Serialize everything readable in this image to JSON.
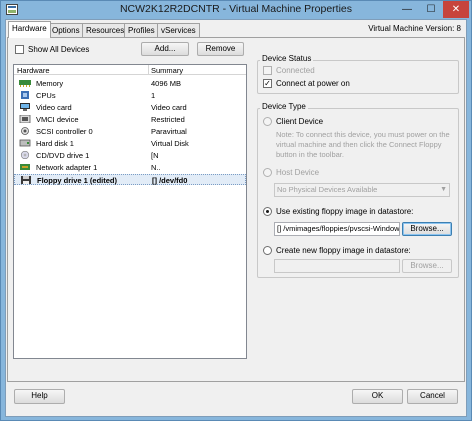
{
  "window": {
    "title": "NCW2K12R2DCNTR - Virtual Machine Properties",
    "controls": {
      "minimize": "—",
      "maximize": "☐",
      "close": "✕"
    }
  },
  "tabs": [
    "Hardware",
    "Options",
    "Resources",
    "Profiles",
    "vServices"
  ],
  "vm_version": "Virtual Machine Version: 8",
  "hardware": {
    "show_all_devices_label": "Show All Devices",
    "add_label": "Add...",
    "remove_label": "Remove",
    "columns": {
      "name": "Hardware",
      "summary": "Summary"
    },
    "rows": [
      {
        "name": "Memory",
        "summary": "4096 MB",
        "icon": "memory-icon"
      },
      {
        "name": "CPUs",
        "summary": "1",
        "icon": "cpu-icon"
      },
      {
        "name": "Video card",
        "summary": "Video card",
        "icon": "video-card-icon"
      },
      {
        "name": "VMCI device",
        "summary": "Restricted",
        "icon": "vmci-device-icon"
      },
      {
        "name": "SCSI controller 0",
        "summary": "Paravirtual",
        "icon": "scsi-controller-icon"
      },
      {
        "name": "Hard disk 1",
        "summary": "Virtual Disk",
        "icon": "hard-disk-icon"
      },
      {
        "name": "CD/DVD drive 1",
        "summary": "[N",
        "icon": "cd-dvd-icon"
      },
      {
        "name": "Network adapter 1",
        "summary": "N..",
        "icon": "network-adapter-icon"
      },
      {
        "name": "Floppy drive 1 (edited)",
        "summary": "[] /dev/fd0",
        "icon": "floppy-drive-icon",
        "selected": true
      }
    ]
  },
  "device_status": {
    "title": "Device Status",
    "connected_label": "Connected",
    "connected_checked": false,
    "connect_at_power_on_label": "Connect at power on",
    "connect_at_power_on_checked": true
  },
  "device_type": {
    "title": "Device Type",
    "client_device_label": "Client Device",
    "note": "Note: To connect this device, you must power on the virtual machine and then click the Connect Floppy button in the toolbar.",
    "host_device_label": "Host Device",
    "host_device_value": "No Physical Devices Available",
    "use_existing_label": "Use existing floppy image in datastore:",
    "existing_path": "[] /vmimages/floppies/pvscsi-Window",
    "browse_label": "Browse...",
    "create_new_label": "Create new floppy image in datastore:",
    "create_browse_label": "Browse...",
    "selected_option": "use_existing"
  },
  "footer": {
    "help_label": "Help",
    "ok_label": "OK",
    "cancel_label": "Cancel"
  },
  "colors": {
    "title_bar": "#87b6dc",
    "close_button": "#c7443c",
    "selected_row": "#e2ecf7",
    "focus_border": "#3c7fb1"
  }
}
